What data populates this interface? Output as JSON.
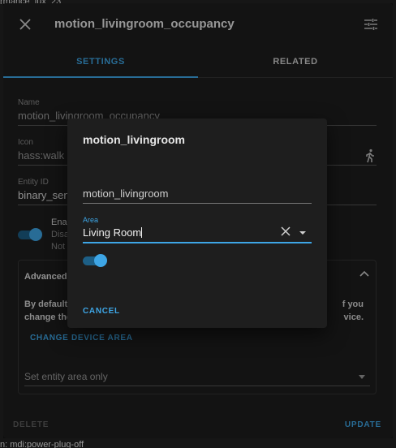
{
  "background": {
    "fragment_top": "rmance_lux_23",
    "fragment_bottom": "n: mdi:power-plug-off"
  },
  "dialog": {
    "title": "motion_livingroom_occupancy",
    "tabs": [
      {
        "label": "SETTINGS",
        "active": true
      },
      {
        "label": "RELATED",
        "active": false
      }
    ],
    "name": {
      "label": "Name",
      "value": "motion_livingroom_occupancy"
    },
    "icon": {
      "label": "Icon",
      "value": "hass:walk",
      "icon": "walk-icon"
    },
    "entity_id": {
      "label": "Entity ID",
      "value": "binary_sen"
    },
    "enable": {
      "title": "Ena",
      "line2": "Disa",
      "line3": "Not"
    },
    "advanced": {
      "title": "Advanced",
      "text_left_1": "By default",
      "text_right_1": "f you",
      "text_left_2": "change the",
      "text_right_2": "vice.",
      "change_area_label": "CHANGE DEVICE AREA",
      "set_area_placeholder": "Set entity area only"
    },
    "delete_label": "DELETE",
    "update_label": "UPDATE"
  },
  "device_dialog": {
    "title": "motion_livingroom",
    "name_value": "motion_livingroom",
    "area": {
      "label": "Area",
      "value": "Living Room"
    },
    "toggle_on": true,
    "cancel_label": "CANCEL"
  },
  "colors": {
    "accent": "#3ea6e6",
    "surface": "#1e1e1e",
    "background": "#161616"
  }
}
